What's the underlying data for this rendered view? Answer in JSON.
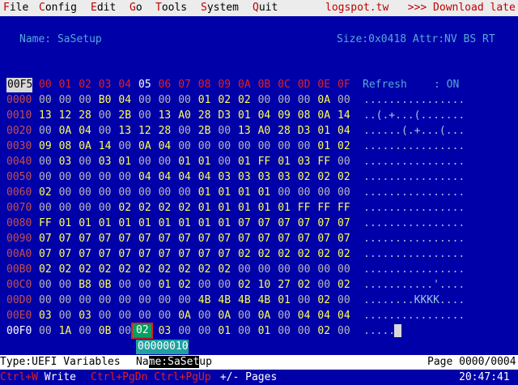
{
  "menu": {
    "items": [
      {
        "hk": "F",
        "rest": "ile"
      },
      {
        "hk": "C",
        "rest": "onfig"
      },
      {
        "hk": "E",
        "rest": "dit"
      },
      {
        "hk": "G",
        "rest": "o"
      },
      {
        "hk": "T",
        "rest": "ools"
      },
      {
        "hk": "S",
        "rest": "ystem"
      },
      {
        "hk": "Q",
        "rest": "uit"
      }
    ],
    "right_text": "logspot.tw   >>> Download late"
  },
  "info": {
    "name": "Name: SaSetup",
    "size_attr": "Size:0x0418 Attr:NV BS RT"
  },
  "editor": {
    "header_offset": "00F5",
    "columns": [
      "00",
      "01",
      "02",
      "03",
      "04",
      "05",
      "06",
      "07",
      "08",
      "09",
      "0A",
      "0B",
      "0C",
      "0D",
      "0E",
      "0F"
    ],
    "highlight_column": "05",
    "refresh_label": "Refresh",
    "refresh_value": ": ON",
    "rows": [
      {
        "offset": "0000",
        "bytes": [
          "00",
          "00",
          "00",
          "B0",
          "04",
          "00",
          "00",
          "00",
          "01",
          "02",
          "02",
          "00",
          "00",
          "00",
          "0A",
          "00"
        ],
        "ascii": "................"
      },
      {
        "offset": "0010",
        "bytes": [
          "13",
          "12",
          "28",
          "00",
          "2B",
          "00",
          "13",
          "A0",
          "28",
          "D3",
          "01",
          "04",
          "09",
          "08",
          "0A",
          "14"
        ],
        "ascii": "..(.+...(......."
      },
      {
        "offset": "0020",
        "bytes": [
          "00",
          "0A",
          "04",
          "00",
          "13",
          "12",
          "28",
          "00",
          "2B",
          "00",
          "13",
          "A0",
          "28",
          "D3",
          "01",
          "04"
        ],
        "ascii": "......(.+...(..."
      },
      {
        "offset": "0030",
        "bytes": [
          "09",
          "08",
          "0A",
          "14",
          "00",
          "0A",
          "04",
          "00",
          "00",
          "00",
          "00",
          "00",
          "00",
          "00",
          "01",
          "02"
        ],
        "ascii": "................"
      },
      {
        "offset": "0040",
        "bytes": [
          "00",
          "03",
          "00",
          "03",
          "01",
          "00",
          "00",
          "01",
          "01",
          "00",
          "01",
          "FF",
          "01",
          "03",
          "FF",
          "00"
        ],
        "ascii": "................"
      },
      {
        "offset": "0050",
        "bytes": [
          "00",
          "00",
          "00",
          "00",
          "00",
          "04",
          "04",
          "04",
          "04",
          "03",
          "03",
          "03",
          "03",
          "02",
          "02",
          "02"
        ],
        "ascii": "................"
      },
      {
        "offset": "0060",
        "bytes": [
          "02",
          "00",
          "00",
          "00",
          "00",
          "00",
          "00",
          "00",
          "01",
          "01",
          "01",
          "01",
          "00",
          "00",
          "00",
          "00"
        ],
        "ascii": "................"
      },
      {
        "offset": "0070",
        "bytes": [
          "00",
          "00",
          "00",
          "00",
          "02",
          "02",
          "02",
          "02",
          "01",
          "01",
          "01",
          "01",
          "01",
          "FF",
          "FF",
          "FF"
        ],
        "ascii": "................"
      },
      {
        "offset": "0080",
        "bytes": [
          "FF",
          "01",
          "01",
          "01",
          "01",
          "01",
          "01",
          "01",
          "01",
          "01",
          "07",
          "07",
          "07",
          "07",
          "07",
          "07"
        ],
        "ascii": "................"
      },
      {
        "offset": "0090",
        "bytes": [
          "07",
          "07",
          "07",
          "07",
          "07",
          "07",
          "07",
          "07",
          "07",
          "07",
          "07",
          "07",
          "07",
          "07",
          "07",
          "07"
        ],
        "ascii": "................"
      },
      {
        "offset": "00A0",
        "bytes": [
          "07",
          "07",
          "07",
          "07",
          "07",
          "07",
          "07",
          "07",
          "07",
          "07",
          "02",
          "02",
          "02",
          "02",
          "02",
          "02"
        ],
        "ascii": "................"
      },
      {
        "offset": "00B0",
        "bytes": [
          "02",
          "02",
          "02",
          "02",
          "02",
          "02",
          "02",
          "02",
          "02",
          "02",
          "00",
          "00",
          "00",
          "00",
          "00",
          "00"
        ],
        "ascii": "................"
      },
      {
        "offset": "00C0",
        "bytes": [
          "00",
          "00",
          "B8",
          "0B",
          "00",
          "00",
          "01",
          "02",
          "00",
          "00",
          "02",
          "10",
          "27",
          "02",
          "00",
          "02"
        ],
        "ascii": "...........'...."
      },
      {
        "offset": "00D0",
        "bytes": [
          "00",
          "00",
          "00",
          "00",
          "00",
          "00",
          "00",
          "00",
          "4B",
          "4B",
          "4B",
          "4B",
          "01",
          "00",
          "02",
          "00"
        ],
        "ascii": "........KKKK...."
      },
      {
        "offset": "00E0",
        "bytes": [
          "03",
          "00",
          "03",
          "00",
          "00",
          "00",
          "00",
          "0A",
          "00",
          "0A",
          "00",
          "0A",
          "00",
          "04",
          "04",
          "04"
        ],
        "ascii": "................"
      },
      {
        "offset": "00F0",
        "bytes": [
          "00",
          "1A",
          "00",
          "0B",
          "00",
          "02",
          "03",
          "00",
          "00",
          "01",
          "00",
          "01",
          "00",
          "00",
          "02",
          "00"
        ],
        "ascii": "....."
      }
    ],
    "selected_value": "02",
    "tooltip": "00000010"
  },
  "status": {
    "type": "Type:UEFI Variables",
    "name_prefix": "Na",
    "name_highlight": "me:SaSet",
    "name_suffix": "up",
    "page": "Page 0000/0004"
  },
  "bottom": {
    "ctrl_w": "Ctrl+W",
    "write": " Write",
    "pg_keys": "Ctrl+PgDn Ctrl+PgUp",
    "pages": " +/- Pages",
    "time": "20:47:41"
  },
  "colors": {
    "background": "#0000a8",
    "menubar": "#ececec",
    "hotkey": "#c00000",
    "selected": "#00a060",
    "tooltip": "#20a0a0"
  }
}
